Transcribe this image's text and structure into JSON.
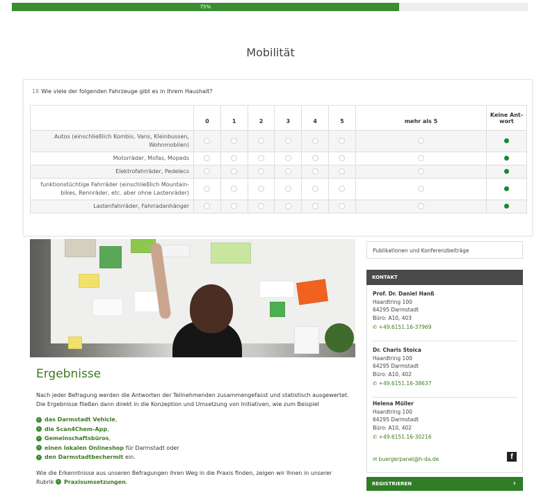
{
  "progress": {
    "label": "75%",
    "value": 0.75
  },
  "section_title": "Mobilität",
  "question": {
    "number": "18",
    "text": "Wie viele der folgenden Fahrzeuge gibt es in Ihrem Haushalt?",
    "columns": [
      "0",
      "1",
      "2",
      "3",
      "4",
      "5",
      "mehr als 5",
      "Keine Ant-wort"
    ],
    "rows": [
      {
        "label": "Autos (einschließlich Kombis, Vans, Kleinbussen, Wohnmobilen)",
        "selected": 7
      },
      {
        "label": "Motorräder, Mofas, Mopeds",
        "selected": 7
      },
      {
        "label": "Elektrofahrräder, Pedelecs",
        "selected": 7
      },
      {
        "label": "funktionstüchtige Fahrräder (einschließlich Mountain-bikes, Rennräder, etc. aber ohne Lastenräder)",
        "selected": 7
      },
      {
        "label": "Lastenfahrräder, Fahrradanhänger",
        "selected": 7
      }
    ]
  },
  "results": {
    "heading": "Ergebnisse",
    "intro": "Nach jeder Befragung werden die Antworten der Teilnehmenden zusammengefasst und statistisch ausgewertet. Die Ergebnisse fließen dann direkt in die Konzeption und Umsetzung von Initiativen, wie zum Beispiel",
    "items": [
      {
        "link": "das Darmstadt Vehicle",
        "rest": ","
      },
      {
        "link": "die Scan4Chem-App",
        "rest": ","
      },
      {
        "link": "Gemeinschaftsbüros",
        "rest": ","
      },
      {
        "link": "einen lokalen Onlineshop",
        "rest": " für Darmstadt oder"
      },
      {
        "link": "den Darmstadtbechermit",
        "rest": " ein."
      }
    ],
    "outro_text": "Wie die Erkenntnisse aus unseren Befragungen ihren Weg in die Praxis finden, zeigen wir Ihnen in unserer Rubrik",
    "outro_link": "Praxisumsetzungen",
    "outro_end": "."
  },
  "sidebar": {
    "publications": "Publikationen und Konferenzbeiträge",
    "contact_header": "KONTAKT",
    "contacts": [
      {
        "name": "Prof. Dr. Daniel Hanß",
        "street": "Haardtring 100",
        "city": "64295 Darmstadt",
        "room": "Büro: A10, 403",
        "phone": "+49.6151.16-37969"
      },
      {
        "name": "Dr. Charis Stoica",
        "street": "Haardtring 100",
        "city": "64295 Darmstadt",
        "room": "Büro: A10, 402",
        "phone": "+49.6151.16-38637"
      },
      {
        "name": "Helena Müller",
        "street": "Haardtring 100",
        "city": "64295 Darmstadt",
        "room": "Büro: A10, 402",
        "phone": "+49.6151.16-30216"
      }
    ],
    "email": "buergerpanel@h-da.de",
    "register": "REGISTRIEREN"
  },
  "colors": {
    "accent": "#3c8d32",
    "selected_radio": "#1a8a2c",
    "heading_green": "#3c7a1f"
  }
}
